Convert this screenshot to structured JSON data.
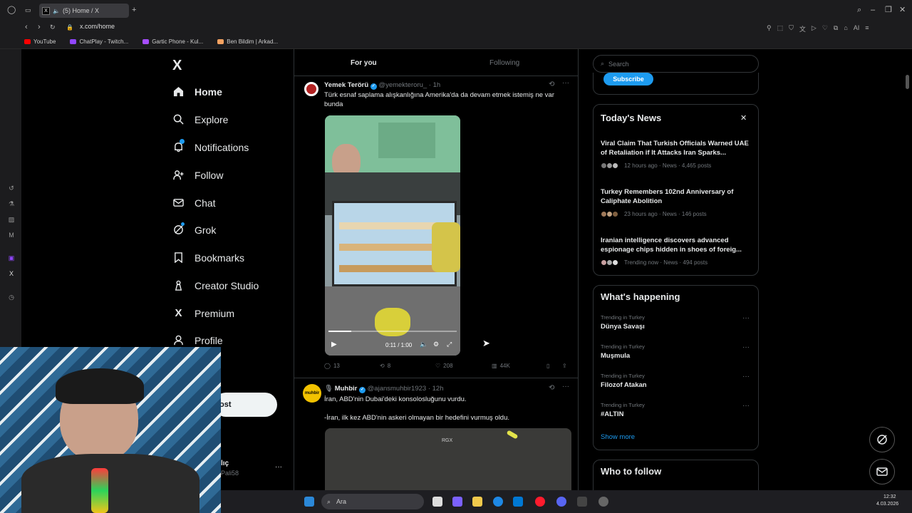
{
  "browser": {
    "tab_title": "(5) Home / X",
    "url": "x.com/home",
    "bookmarks": [
      {
        "label": "YouTube",
        "color": "#ff0000"
      },
      {
        "label": "ChatPlay - Twitch...",
        "color": "#9146ff"
      },
      {
        "label": "Gartic Phone - Kul...",
        "color": "#a64dff"
      },
      {
        "label": "Ben Bildim | Arkad...",
        "color": "#f4a261"
      }
    ]
  },
  "nav": {
    "logo": "X",
    "items": [
      {
        "label": "Home",
        "icon": "home-icon"
      },
      {
        "label": "Explore",
        "icon": "search-icon"
      },
      {
        "label": "Notifications",
        "icon": "bell-icon"
      },
      {
        "label": "Follow",
        "icon": "follow-icon"
      },
      {
        "label": "Chat",
        "icon": "mail-icon"
      },
      {
        "label": "Grok",
        "icon": "grok-icon"
      },
      {
        "label": "Bookmarks",
        "icon": "bookmark-icon"
      },
      {
        "label": "Creator Studio",
        "icon": "creator-icon"
      },
      {
        "label": "Premium",
        "icon": "x-premium-icon"
      },
      {
        "label": "Profile",
        "icon": "profile-icon"
      }
    ],
    "post_button_partial": "ost",
    "account_name_partial": "lıç",
    "account_handle_partial": "Pali58"
  },
  "feed": {
    "tabs": [
      "For you",
      "Following"
    ],
    "post1": {
      "name": "Yemek Terörü",
      "handle": "@yemekteroru_",
      "time": "· 1h",
      "text": "Türk esnaf saplama alışkanlığına Amerika'da da devam etmek istemiş ne var bunda",
      "video_time": "0:11 / 1:00",
      "video_progress": 0.18,
      "replies": "13",
      "reposts": "8",
      "likes": "208",
      "views": "44K"
    },
    "post2": {
      "name": "Muhbir",
      "handle": "@ajansmuhbir1923",
      "time": "· 12h",
      "line1": "İran, ABD'nin Dubai'deki konsolosluğunu vurdu.",
      "line2": "-İran, ilk kez ABD'nin askeri olmayan bir hedefini vurmuş oldu.",
      "media_watermark": "RGX",
      "avatar_text": "muhbir"
    }
  },
  "right": {
    "search_placeholder": "Search",
    "subscribe_label": "Subscribe",
    "news_title": "Today's News",
    "news": [
      {
        "headline": "Viral Claim That Turkish Officials Warned UAE of Retaliation if It Attacks Iran Sparks...",
        "meta": "12 hours ago · News · 4,465 posts"
      },
      {
        "headline": "Turkey Remembers 102nd Anniversary of Caliphate Abolition",
        "meta": "23 hours ago · News · 146 posts"
      },
      {
        "headline": "Iranian intelligence discovers advanced espionage chips hidden in shoes of foreig...",
        "meta": "Trending now · News · 494 posts"
      }
    ],
    "happening_title": "What's happening",
    "trends": [
      {
        "context": "Trending in Turkey",
        "name": "Dünya Savaşı"
      },
      {
        "context": "Trending in Turkey",
        "name": "Muşmula"
      },
      {
        "context": "Trending in Turkey",
        "name": "Filozof Atakan"
      },
      {
        "context": "Trending in Turkey",
        "name": "#ALTIN"
      }
    ],
    "show_more": "Show more",
    "who_to_follow": "Who to follow"
  },
  "taskbar": {
    "search_placeholder": "Ara",
    "time": "12:32",
    "date": "4.03.2026"
  },
  "colors": {
    "accent": "#1d9bf0",
    "border": "#2f3336",
    "muted": "#71767b"
  }
}
